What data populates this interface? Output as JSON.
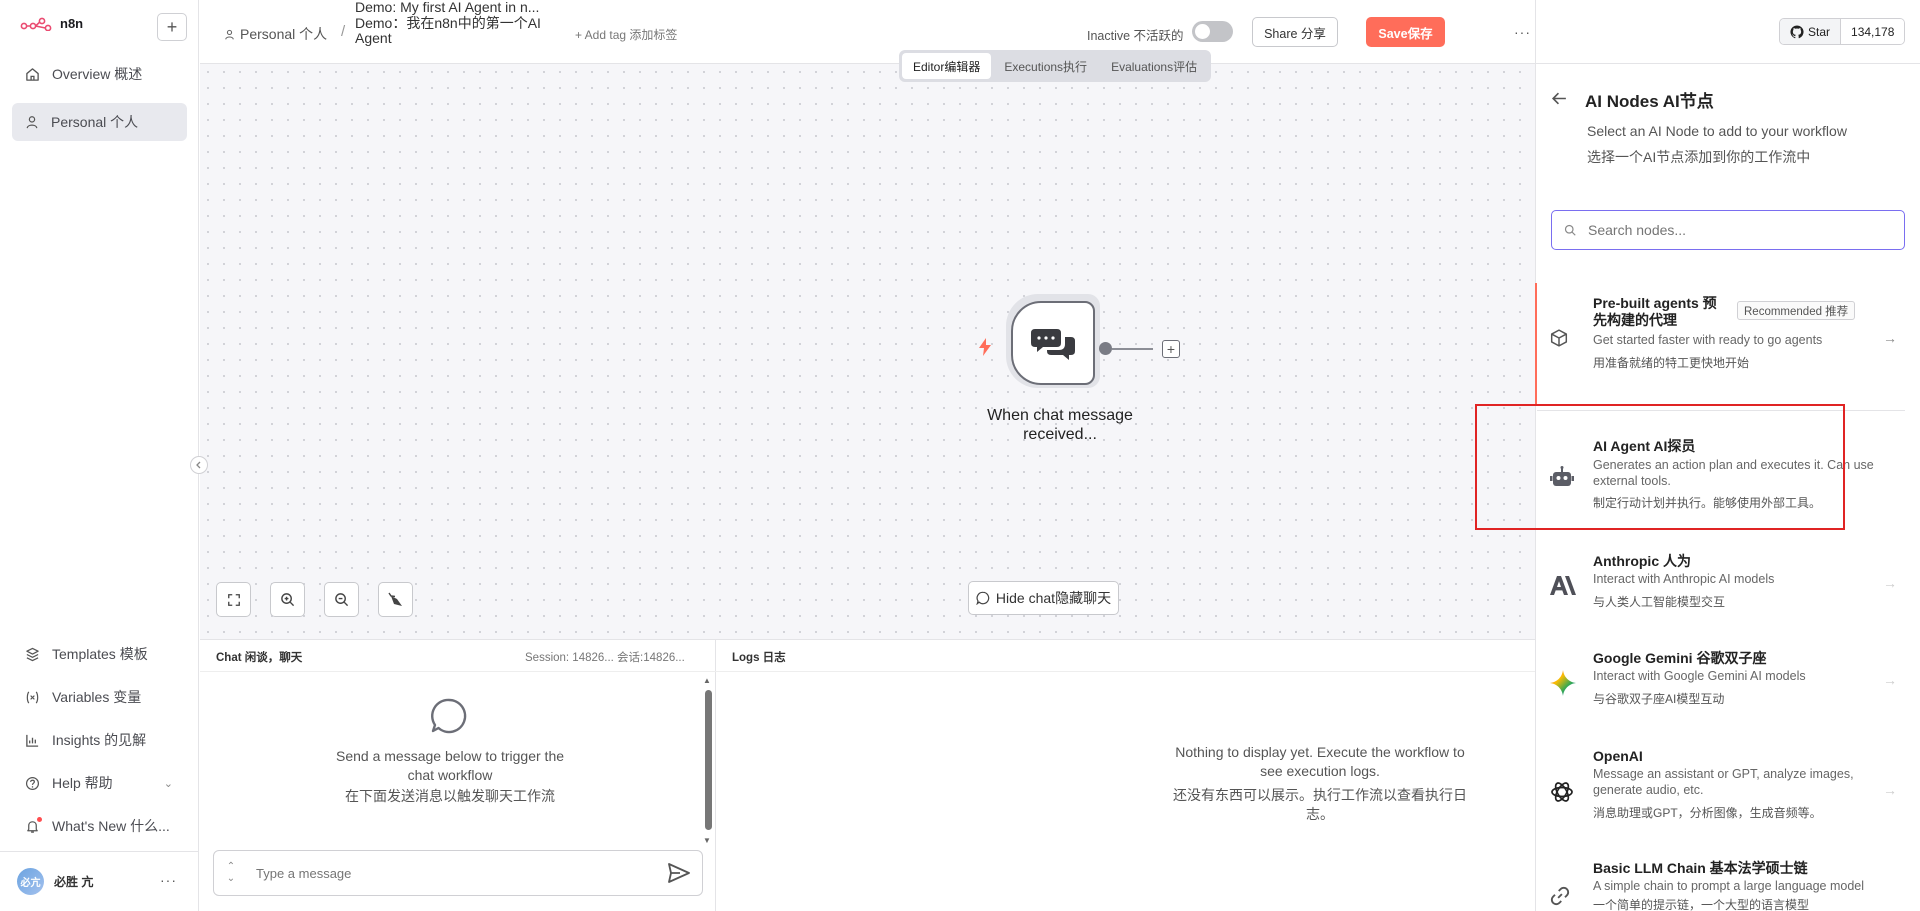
{
  "app": {
    "logo_text": "n8n"
  },
  "sidebar": {
    "add_label": "+",
    "items": [
      {
        "label": "Overview 概述",
        "icon": "home-icon"
      },
      {
        "label": "Personal 个人",
        "icon": "user-icon",
        "active": true
      }
    ],
    "bottom_items": [
      {
        "label": "Templates 模板",
        "icon": "box-icon"
      },
      {
        "label": "Variables 变量",
        "icon": "variable-icon"
      },
      {
        "label": "Insights 的见解",
        "icon": "chart-icon"
      },
      {
        "label": "Help 帮助",
        "icon": "help-icon",
        "chevron": "⌄"
      },
      {
        "label": "What's New 什么...",
        "icon": "bell-icon"
      }
    ],
    "user": {
      "name": "必胜 亢",
      "avatar_text": "必亢"
    },
    "more": "···"
  },
  "header": {
    "breadcrumb_project": "Personal 个人",
    "separator": "/",
    "workflow_title_lines": [
      "Demo: My first AI Agent in n...",
      "Demo：我在n8n中的第一个AI",
      "Agent"
    ],
    "add_tag": "+ Add tag 添加标签",
    "status_label": "Inactive 不活跃的",
    "share_label": "Share 分享",
    "save_label": "Save保存",
    "more": "···",
    "github": {
      "star_label": "Star",
      "count": "134,178"
    }
  },
  "canvas": {
    "tabs": [
      {
        "label": "Editor编辑器",
        "active": true
      },
      {
        "label": "Executions执行",
        "active": false
      },
      {
        "label": "Evaluations评估",
        "active": false
      }
    ],
    "node_label": "When chat message received...",
    "node_plus": "+",
    "hide_chat_label": "Hide chat隐藏聊天"
  },
  "chat_panel": {
    "title": "Chat 闲谈，聊天",
    "session": "Session: 14826... 会话:14826...",
    "empty_en": "Send a message below to trigger the chat workflow",
    "empty_cn": "在下面发送消息以触发聊天工作流",
    "input_placeholder": "Type a message"
  },
  "logs_panel": {
    "title": "Logs 日志",
    "empty_en": "Nothing to display yet. Execute the workflow to see execution logs.",
    "empty_cn": "还没有东西可以展示。执行工作流以查看执行日志。"
  },
  "right_panel": {
    "title": "AI Nodes AI节点",
    "subtitle_en": "Select an AI Node to add to your workflow",
    "subtitle_cn": "选择一个AI节点添加到你的工作流中",
    "search_placeholder": "Search nodes...",
    "badge": "Recommended 推荐",
    "items": [
      {
        "title": "Pre-built agents 预先构建的代理",
        "desc": "Get started faster with ready to go agents",
        "cn": "用准备就绪的特工更快地开始",
        "icon": "cube-icon"
      },
      {
        "title": "AI Agent AI探员",
        "desc": "Generates an action plan and executes it. Can use external tools.",
        "cn": "制定行动计划并执行。能够使用外部工具。",
        "icon": "robot-icon"
      },
      {
        "title": "Anthropic 人为",
        "desc": "Interact with Anthropic AI models",
        "cn": "与人类人工智能模型交互",
        "icon": "anthropic-icon"
      },
      {
        "title": "Google Gemini 谷歌双子座",
        "desc": "Interact with Google Gemini AI models",
        "cn": "与谷歌双子座AI模型互动",
        "icon": "gemini-icon"
      },
      {
        "title": "OpenAI",
        "desc": "Message an assistant or GPT, analyze images, generate audio, etc.",
        "cn": "消息助理或GPT，分析图像，生成音频等。",
        "icon": "openai-icon"
      },
      {
        "title": "Basic LLM Chain 基本法学硕士链",
        "desc": "A simple chain to prompt a large language model",
        "cn": "一个简单的提示链，一个大型的语言模型",
        "icon": "link-icon"
      }
    ],
    "arrow": "→"
  },
  "colors": {
    "accent": "#ff6d5a",
    "search_border": "#7a6ef0",
    "highlight": "#e02424"
  }
}
